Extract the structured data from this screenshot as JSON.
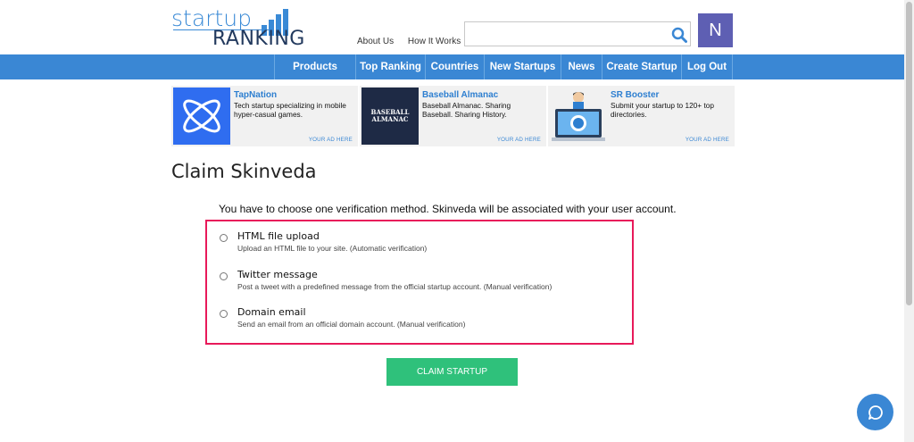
{
  "header": {
    "logo_top": "startup",
    "logo_bottom": "RANKING",
    "links": [
      "About Us",
      "How It Works"
    ],
    "search": {
      "value": "",
      "placeholder": ""
    },
    "avatar_letter": "N"
  },
  "nav": {
    "items": [
      "Products",
      "Top Ranking",
      "Countries",
      "New Startups",
      "News",
      "Create Startup",
      "Log Out"
    ],
    "color": "#3a87d4"
  },
  "ads": [
    {
      "title": "TapNation",
      "desc": "Tech startup specializing in mobile hyper-casual games.",
      "footer": "YOUR AD HERE"
    },
    {
      "title": "Baseball Almanac",
      "desc": "Baseball Almanac. Sharing Baseball. Sharing History.",
      "footer": "YOUR AD HERE",
      "logo_text": "BASEBALL ALMANAC"
    },
    {
      "title": "SR Booster",
      "desc": "Submit your startup to 120+ top directories.",
      "footer": "YOUR AD HERE"
    }
  ],
  "page": {
    "title": "Claim Skinveda",
    "intro": "You have to choose one verification method. Skinveda will be associated with your user account."
  },
  "methods": [
    {
      "title": "HTML file upload",
      "desc": "Upload an HTML file to your site. (Automatic verification)"
    },
    {
      "title": "Twitter message",
      "desc": "Post a tweet with a predefined message from the official startup account. (Manual verification)"
    },
    {
      "title": "Domain email",
      "desc": "Send an email from an official domain account. (Manual verification)"
    }
  ],
  "claim_button": "CLAIM STARTUP",
  "colors": {
    "accent": "#3a87d4",
    "highlight_border": "#e8195a",
    "claim_button": "#2fc17b",
    "avatar": "#5e5fb3"
  }
}
